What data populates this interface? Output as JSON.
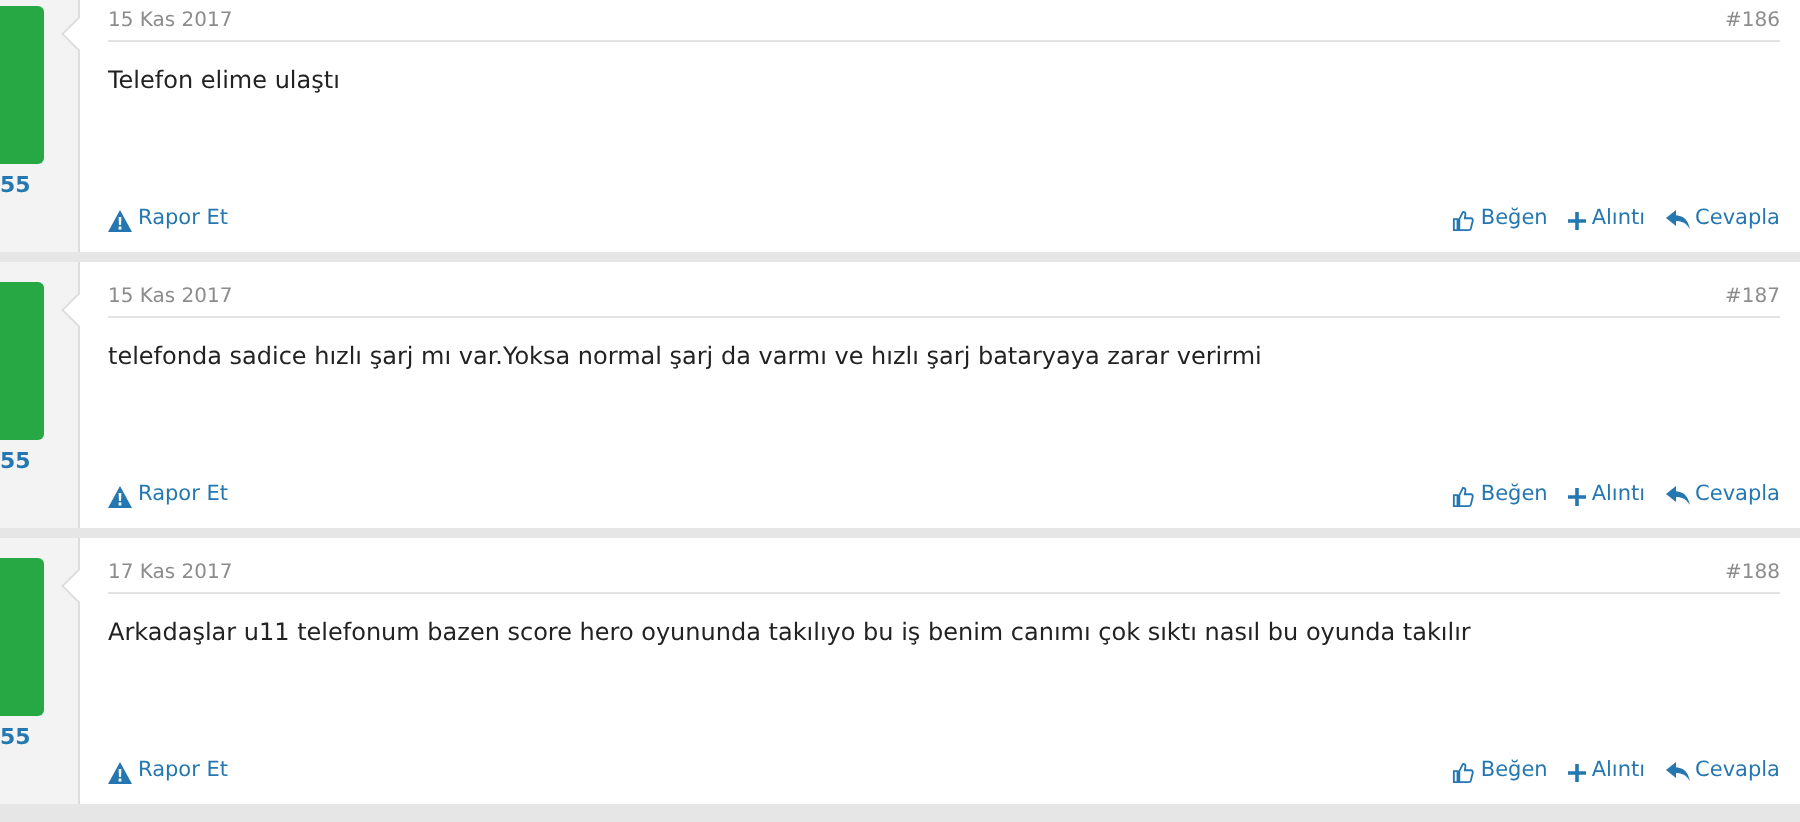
{
  "posts": [
    {
      "user_count": "55",
      "date": "15 Kas 2017",
      "number": "#186",
      "message": "Telefon elime ulaştı",
      "report": "Rapor Et",
      "actions": [
        "Beğen",
        "Alıntı",
        "Cevapla"
      ]
    },
    {
      "user_count": "55",
      "date": "15 Kas 2017",
      "number": "#187",
      "message": "telefonda sadice hızlı şarj mı var.Yoksa normal şarj da varmı ve hızlı şarj bataryaya zarar verirmi",
      "report": "Rapor Et",
      "actions": [
        "Beğen",
        "Alıntı",
        "Cevapla"
      ]
    },
    {
      "user_count": "55",
      "date": "17 Kas 2017",
      "number": "#188",
      "message": "Arkadaşlar u11 telefonum bazen score hero oyununda takılıyo bu iş benim canımı çok sıktı nasıl bu oyunda takılır",
      "report": "Rapor Et",
      "actions": [
        "Beğen",
        "Alıntı",
        "Cevapla"
      ]
    }
  ]
}
